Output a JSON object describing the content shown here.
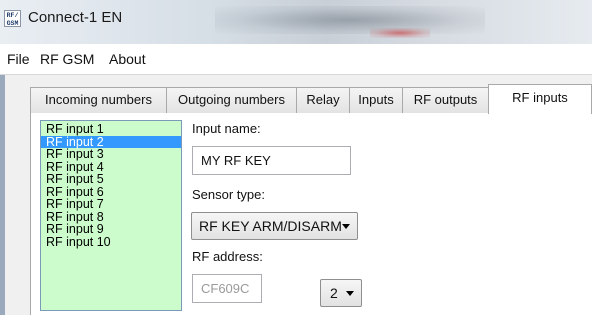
{
  "window": {
    "icon_text": [
      "RF/",
      "GSM"
    ],
    "title": "Connect-1 EN"
  },
  "menu": [
    "File",
    "RF GSM",
    "About"
  ],
  "tabs": [
    {
      "label": "Incoming numbers",
      "active": false
    },
    {
      "label": "Outgoing numbers",
      "active": false
    },
    {
      "label": "Relay",
      "active": false
    },
    {
      "label": "Inputs",
      "active": false
    },
    {
      "label": "RF outputs",
      "active": false
    },
    {
      "label": "RF inputs",
      "active": true
    }
  ],
  "rf_inputs": {
    "items": [
      "RF input 1",
      "RF input 2",
      "RF input 3",
      "RF input 4",
      "RF input 5",
      "RF input 6",
      "RF input 7",
      "RF input 8",
      "RF input 9",
      "RF input 10"
    ],
    "selected_index": 1,
    "list_background": "#ccfccc",
    "selection_color": "#3399ff"
  },
  "form": {
    "input_name_label": "Input name:",
    "input_name_value": "MY RF KEY",
    "sensor_type_label": "Sensor type:",
    "sensor_type_value": "RF KEY ARM/DISARM",
    "rf_address_label": "RF address:",
    "rf_address_value": "CF609C",
    "rf_address_index": "2"
  }
}
